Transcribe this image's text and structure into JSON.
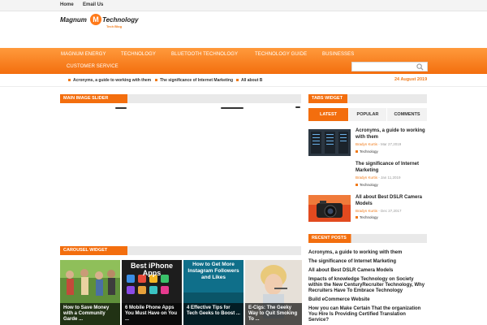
{
  "topnav": {
    "home": "Home",
    "email": "Email Us"
  },
  "logo": {
    "word1": "Magnum",
    "badge": "M",
    "word2": "Technology",
    "tagline": "Tech Blog"
  },
  "nav": {
    "items": [
      "MAGNUM ENERGY",
      "TECHNOLOGY",
      "BLUETOOTH TECHNOLOGY",
      "TECHNOLOGY GUIDE",
      "BUSINESSES",
      "CUSTOMER SERVICE"
    ]
  },
  "search": {
    "placeholder": "",
    "icon": "search-icon"
  },
  "ticker": {
    "items": [
      "Acronyms, a guide to working with them",
      "The significance of Internet Marketing",
      "All about B"
    ],
    "date": "24 August 2019"
  },
  "widgets": {
    "slider_title": "MAIN IMAGE SLIDER",
    "tabs_title": "TABS WIDGET",
    "recent_title": "RECENT POSTS",
    "carousel_title": "CAROUSEL WIDGET"
  },
  "tabs": {
    "latest": "LATEST",
    "popular": "POPULAR",
    "comments": "COMMENTS"
  },
  "tab_posts": [
    {
      "title": "Acronyms, a guide to working with them",
      "author": "Bradyn Kurtis",
      "date": " - Mar 27,2019",
      "category": "Technology"
    },
    {
      "title": "The significance of Internet Marketing",
      "author": "Bradyn Kurtis",
      "date": " - Jan 11,2019",
      "category": "Technology"
    },
    {
      "title": "All about Best DSLR Camera Models",
      "author": "Bradyn Kurtis",
      "date": " - Dec 27,2017",
      "category": "Technology"
    }
  ],
  "recent_posts": [
    "Acronyms, a guide to working with them",
    "The significance of Internet Marketing",
    "All about Best DSLR Camera Models",
    "Impacts of knowledge Technology on Society within the New CenturyRecruiter Technology, Why Recruiters Have To Embrace Technology",
    "Build eCommerce Website",
    "How you can Make Certain That the organization You Hire Is Providing Certified Translation Service?"
  ],
  "carousel": [
    {
      "caption": "How to Save Money with a Community Garde ...",
      "heading": ""
    },
    {
      "caption": "6 Mobile Phone Apps You Must Have on You ...",
      "heading": "Best iPhone Apps"
    },
    {
      "caption": "4 Effective Tips for Tech Geeks to Boost ...",
      "heading": "How to Get More Instagram Followers and Likes"
    },
    {
      "caption": "E-Cigs: The Geeky Way to Quit Smoking To ...",
      "heading": ""
    }
  ],
  "colors": {
    "accent": "#f36e0e",
    "accent_light": "#ff9a3c",
    "meta": "#f07a19"
  }
}
